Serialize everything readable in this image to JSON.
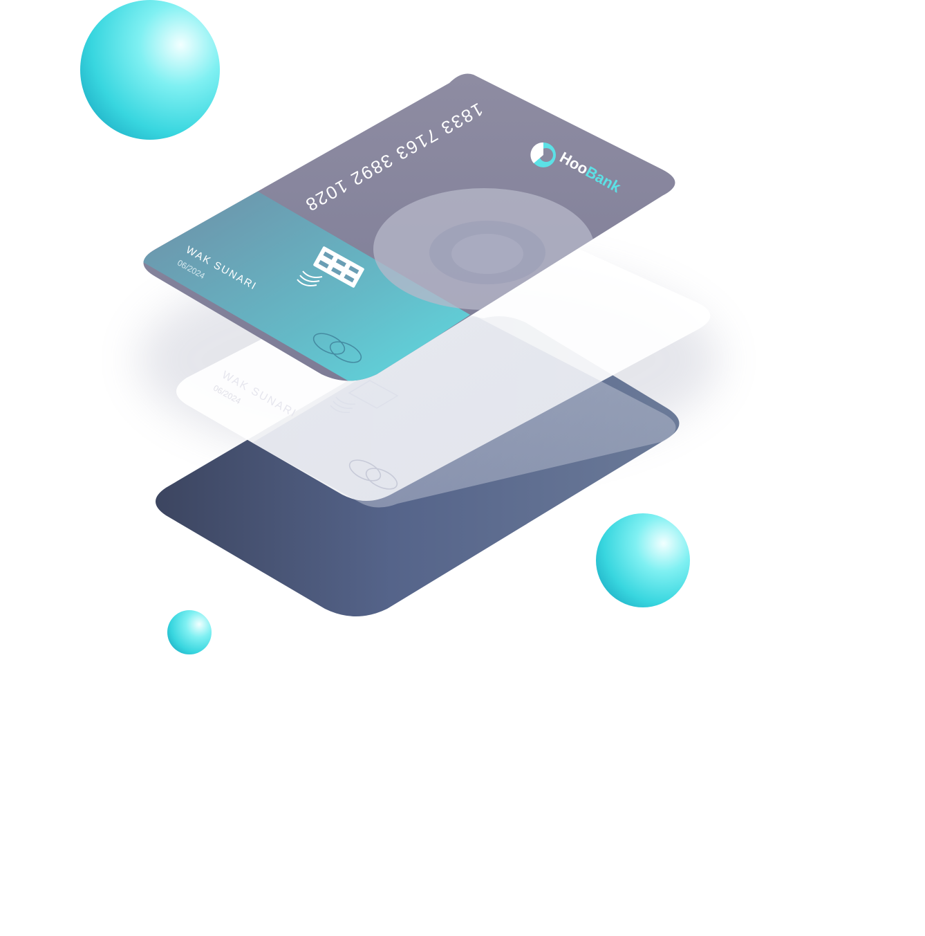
{
  "brand": {
    "prefix": "Hoo",
    "suffix": "Bank",
    "prefix_color": "#ffffff",
    "suffix_color": "#5ce1e6",
    "logo_icon": "hoobank-logo-icon"
  },
  "front_card": {
    "number": "1833 7163 3892 1028",
    "holder": "WAK SUNARI",
    "expiry": "06/2024",
    "base_color": "#8a8aa0",
    "accent_color": "#5ce1e6"
  },
  "middle_card": {
    "holder": "WAK SUNARI",
    "expiry": "06/2024",
    "base_color": "#ffffff"
  },
  "back_card": {
    "base_color": "#55648a"
  },
  "icons": {
    "chip": "chip-icon",
    "contactless": "contactless-icon",
    "network": "card-network-icon"
  },
  "spheres_color": "#33d4de"
}
